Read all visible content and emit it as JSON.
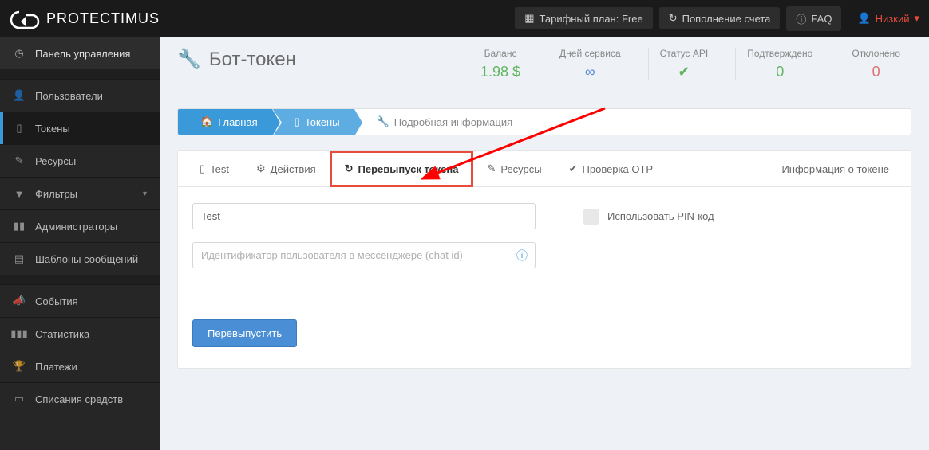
{
  "top": {
    "brand": "PROTECTIMUS",
    "plan": "Тарифный план: Free",
    "topup": "Пополнение счета",
    "faq": "FAQ",
    "user": "Низкий"
  },
  "sidebar": {
    "dashboard": "Панель управления",
    "users": "Пользователи",
    "tokens": "Токены",
    "resources": "Ресурсы",
    "filters": "Фильтры",
    "admins": "Администраторы",
    "templates": "Шаблоны сообщений",
    "events": "События",
    "stats": "Статистика",
    "payments": "Платежи",
    "charges": "Списания средств"
  },
  "page": {
    "title": "Бот-токен"
  },
  "stats": {
    "balance_label": "Баланс",
    "balance_value": "1.98 $",
    "days_label": "Дней сервиса",
    "api_label": "Статус API",
    "confirmed_label": "Подтверждено",
    "confirmed_value": "0",
    "declined_label": "Отклонено",
    "declined_value": "0"
  },
  "breadcrumb": {
    "home": "Главная",
    "tokens": "Токены",
    "details": "Подробная информация"
  },
  "tabs": {
    "test": "Test",
    "actions": "Действия",
    "reissue": "Перевыпуск токена",
    "resources": "Ресурсы",
    "otp": "Проверка OTP",
    "info": "Информация о токене"
  },
  "form": {
    "name_value": "Test",
    "chatid_placeholder": "Идентификатор пользователя в мессенджере (chat id)",
    "pin_label": "Использовать PIN-код",
    "submit": "Перевыпустить"
  }
}
